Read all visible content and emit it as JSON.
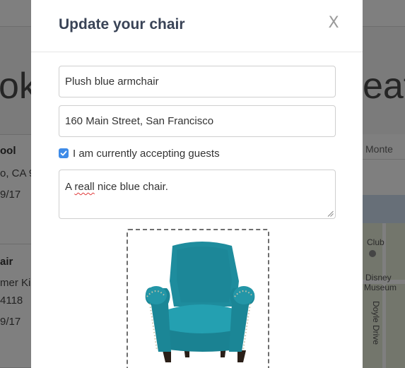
{
  "background": {
    "heading_left": "oki",
    "heading_right": "eat",
    "listings": [
      {
        "title": "ool",
        "lines": [
          "o, CA 9",
          "9/17"
        ]
      },
      {
        "title": "air",
        "lines": [
          "mer Kir",
          "4118",
          "9/17"
        ]
      }
    ],
    "right_tab": "Monte",
    "map_labels": [
      "Club",
      "Disney",
      "Museum",
      "Doyle Drive"
    ]
  },
  "modal": {
    "title": "Update your chair",
    "close_label": "X",
    "name_value": "Plush blue armchair",
    "address_value": "160 Main Street, San Francisco",
    "accepting_label": "I am currently accepting guests",
    "accepting_checked": true,
    "description_before": "A ",
    "description_misspelled": "reall",
    "description_after": " nice blue chair.",
    "photo_alt": "teal-armchair-photo"
  },
  "colors": {
    "accent": "#3e8be8",
    "title": "#394356",
    "chair": "#1e8c9d"
  }
}
